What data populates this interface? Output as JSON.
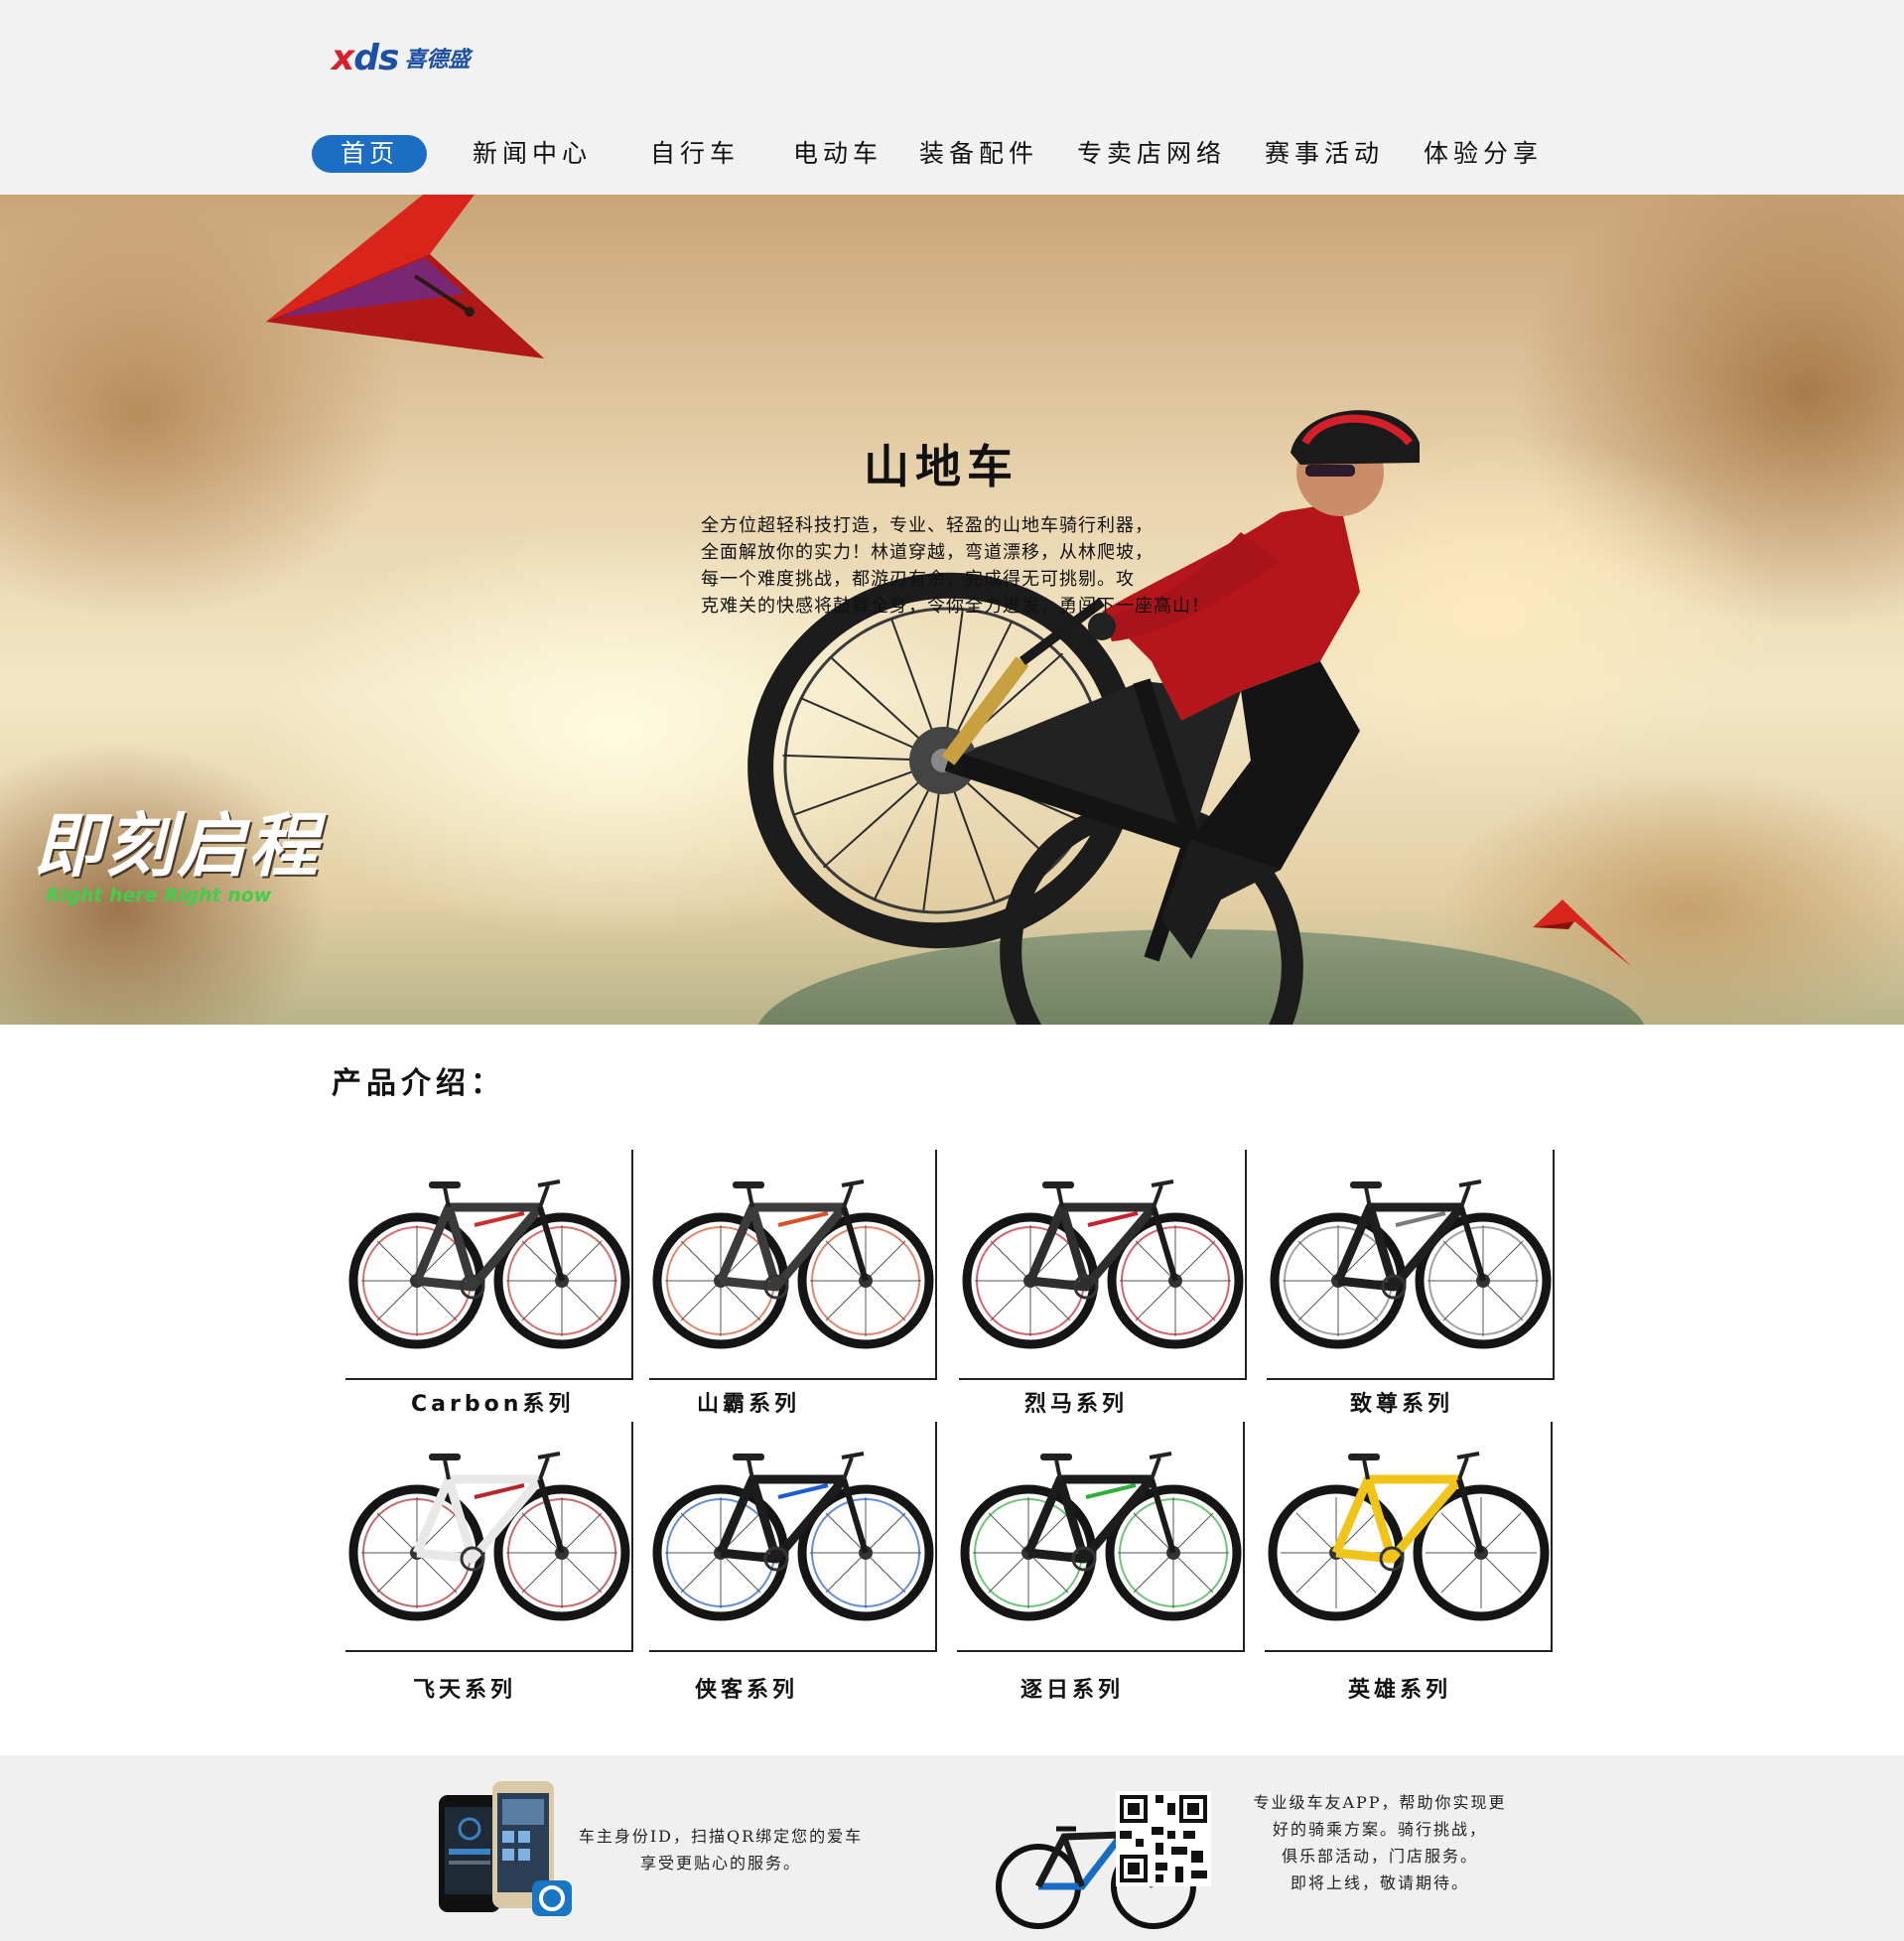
{
  "header": {
    "logo_mark": "xds",
    "logo_cn": "喜德盛"
  },
  "nav": {
    "items": [
      {
        "label": "首页",
        "active": true
      },
      {
        "label": "新闻中心"
      },
      {
        "label": "自行车"
      },
      {
        "label": "电动车"
      },
      {
        "label": "装备配件"
      },
      {
        "label": "专卖店网络"
      },
      {
        "label": "赛事活动"
      },
      {
        "label": "体验分享"
      }
    ]
  },
  "hero": {
    "title": "山地车",
    "lines": [
      "全方位超轻科技打造，专业、轻盈的山地车骑行利器，",
      "全面解放你的实力！林道穿越，弯道漂移，从林爬坡，",
      "每一个难度挑战，都游刃有余，完成得无可挑剔。攻",
      "克难关的快感将鼓舞全身，令你全力迸发，勇闯下一座高山！"
    ],
    "slogan_cn": "即刻启程",
    "slogan_en": "Right here Right now"
  },
  "products": {
    "title": "产品介绍：",
    "items": [
      {
        "label": "Carbon系列",
        "frame": "#3a3a3a",
        "accent": "#c8302c"
      },
      {
        "label": "山霸系列",
        "frame": "#3b3b3b",
        "accent": "#d9502a"
      },
      {
        "label": "烈马系列",
        "frame": "#2e2e2e",
        "accent": "#c8202e"
      },
      {
        "label": "致尊系列",
        "frame": "#1f1f1f",
        "accent": "#7a7a7a"
      },
      {
        "label": "飞天系列",
        "frame": "#e8e8e8",
        "accent": "#b3262a"
      },
      {
        "label": "侠客系列",
        "frame": "#1c1c1c",
        "accent": "#1e5bd1"
      },
      {
        "label": "逐日系列",
        "frame": "#1c1c1c",
        "accent": "#2fae3c"
      },
      {
        "label": "英雄系列",
        "frame": "#f0c419",
        "accent": "#ffffff"
      }
    ]
  },
  "footer": {
    "left_lines": [
      "车主身份ID，扫描QR绑定您的爱车",
      "享受更贴心的服务。"
    ],
    "right_lines": [
      "专业级车友APP，帮助你实现更",
      "好的骑乘方案。骑行挑战，",
      "俱乐部活动，门店服务。",
      "即将上线，敬请期待。"
    ]
  },
  "colors": {
    "nav_active": "#1b6ec3",
    "brand_blue": "#1d4fa3",
    "brand_red": "#d62129"
  }
}
